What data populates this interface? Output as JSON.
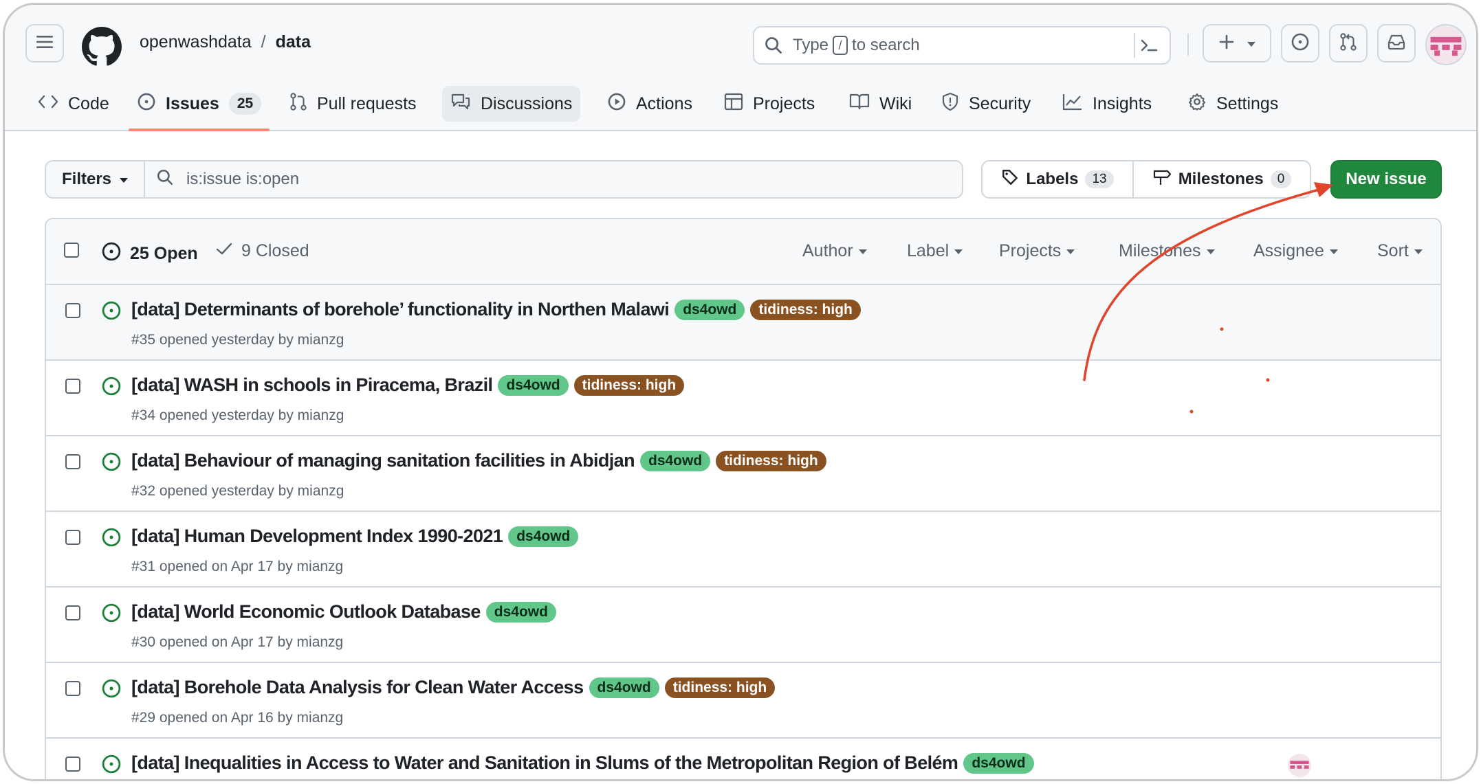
{
  "header": {
    "owner": "openwashdata",
    "separator": "/",
    "repo": "data",
    "search_prefix": "Type",
    "search_key": "/",
    "search_suffix": "to search"
  },
  "tabs": [
    {
      "label": "Code"
    },
    {
      "label": "Issues",
      "count": "25"
    },
    {
      "label": "Pull requests"
    },
    {
      "label": "Discussions"
    },
    {
      "label": "Actions"
    },
    {
      "label": "Projects"
    },
    {
      "label": "Wiki"
    },
    {
      "label": "Security"
    },
    {
      "label": "Insights"
    },
    {
      "label": "Settings"
    }
  ],
  "filters": {
    "button_label": "Filters",
    "query": "is:issue is:open",
    "labels_label": "Labels",
    "labels_count": "13",
    "milestones_label": "Milestones",
    "milestones_count": "0",
    "new_issue_label": "New issue"
  },
  "list_header": {
    "open_label": "25 Open",
    "closed_label": "9 Closed",
    "author": "Author",
    "label": "Label",
    "projects": "Projects",
    "milestones": "Milestones",
    "assignee": "Assignee",
    "sort": "Sort"
  },
  "issues": [
    {
      "title": "[data] Determinants of borehole’ functionality in Northen Malawi",
      "labels": [
        "ds4owd",
        "tidiness: high"
      ],
      "meta": "#35 opened yesterday by mianzg"
    },
    {
      "title": "[data] WASH in schools in Piracema, Brazil",
      "labels": [
        "ds4owd",
        "tidiness: high"
      ],
      "meta": "#34 opened yesterday by mianzg"
    },
    {
      "title": "[data] Behaviour of managing sanitation facilities in Abidjan",
      "labels": [
        "ds4owd",
        "tidiness: high"
      ],
      "meta": "#32 opened yesterday by mianzg"
    },
    {
      "title": "[data] Human Development Index 1990-2021",
      "labels": [
        "ds4owd"
      ],
      "meta": "#31 opened on Apr 17 by mianzg"
    },
    {
      "title": "[data] World Economic Outlook Database",
      "labels": [
        "ds4owd"
      ],
      "meta": "#30 opened on Apr 17 by mianzg"
    },
    {
      "title": "[data] Borehole Data Analysis for Clean Water Access",
      "labels": [
        "ds4owd",
        "tidiness: high"
      ],
      "meta": "#29 opened on Apr 16 by mianzg"
    },
    {
      "title": "[data] Inequalities in Access to Water and Sanitation in Slums of the Metropolitan Region of Belém",
      "labels": [
        "ds4owd"
      ],
      "meta": ""
    }
  ],
  "colors": {
    "accent_open": "#1a7f37",
    "label_green": "#60c689",
    "label_brown": "#8a5121",
    "new_issue_button": "#1f883d",
    "annotation_arrow": "#e0442a"
  }
}
